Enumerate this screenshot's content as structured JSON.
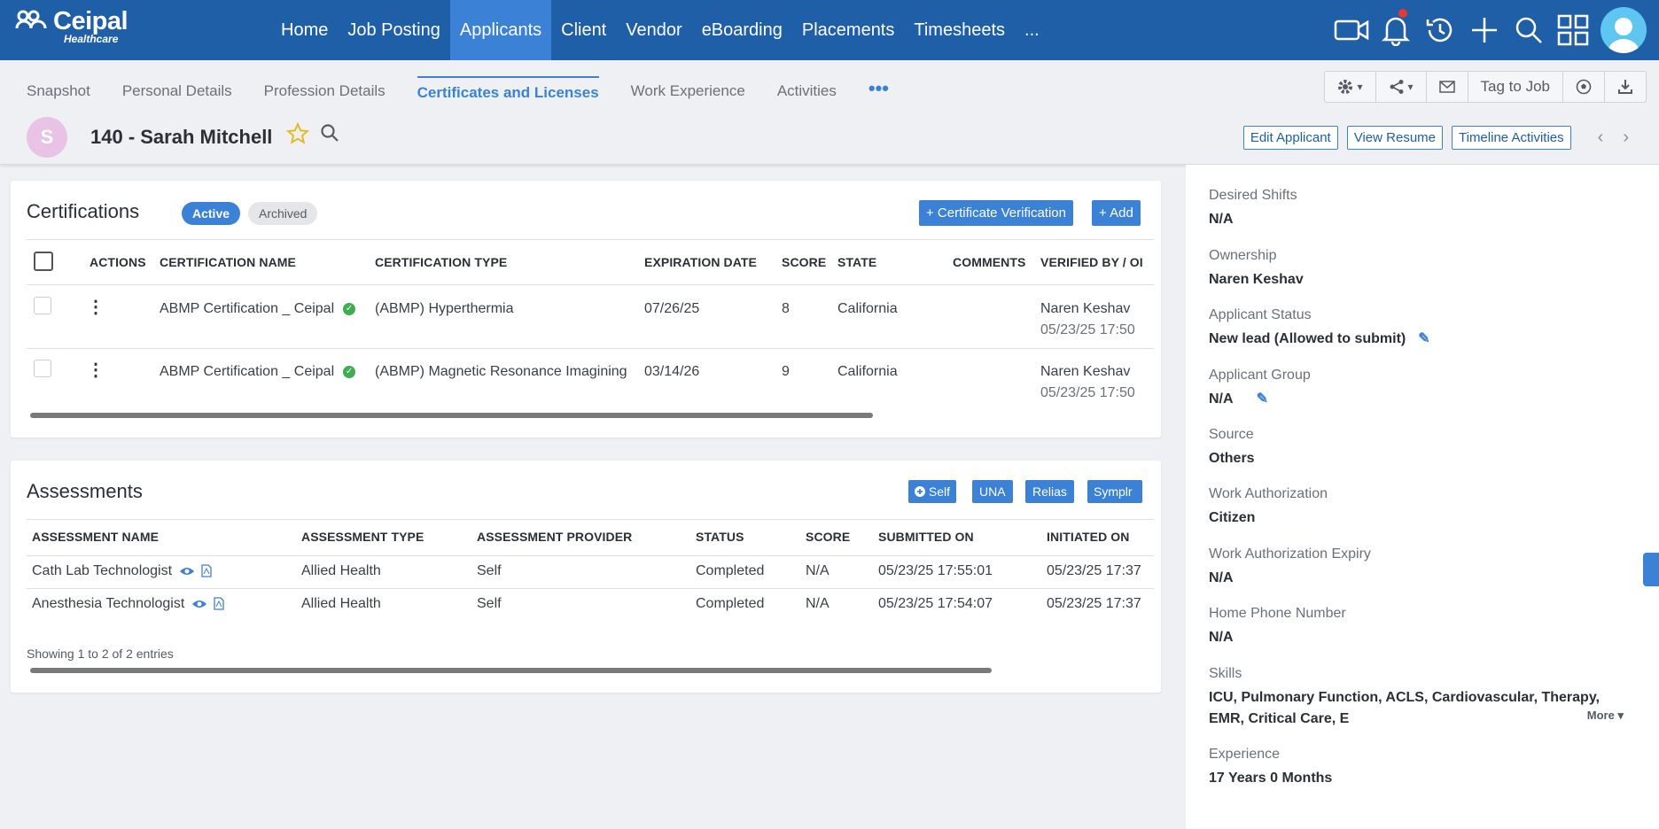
{
  "brand": {
    "name": "Ceipal",
    "sub": "Healthcare"
  },
  "nav": [
    {
      "label": "Home"
    },
    {
      "label": "Job Posting"
    },
    {
      "label": "Applicants",
      "active": true
    },
    {
      "label": "Client"
    },
    {
      "label": "Vendor"
    },
    {
      "label": "eBoarding"
    },
    {
      "label": "Placements"
    },
    {
      "label": "Timesheets"
    },
    {
      "label": "..."
    }
  ],
  "tabs": [
    {
      "label": "Snapshot"
    },
    {
      "label": "Personal Details"
    },
    {
      "label": "Profession Details"
    },
    {
      "label": "Certificates and Licenses",
      "active": true
    },
    {
      "label": "Work Experience"
    },
    {
      "label": "Activities"
    }
  ],
  "toolbar": {
    "tag_to_job": "Tag to Job"
  },
  "profile": {
    "initial": "S",
    "id_name": "140 -  Sarah Mitchell"
  },
  "actions": {
    "edit": "Edit Applicant",
    "resume": "View Resume",
    "timeline": "Timeline Activities"
  },
  "certifications": {
    "title": "Certifications",
    "active": "Active",
    "archived": "Archived",
    "verify_btn": "+ Certificate Verification",
    "add_btn": "+ Add",
    "headers": [
      "ACTIONS",
      "CERTIFICATION NAME",
      "CERTIFICATION TYPE",
      "EXPIRATION DATE",
      "SCORE",
      "STATE",
      "COMMENTS",
      "VERIFIED BY / OI"
    ],
    "rows": [
      {
        "name": "ABMP Certification _ Ceipal",
        "type": "(ABMP) Hyperthermia",
        "expiration": "07/26/25",
        "score": "8",
        "state": "California",
        "verified_by": "Naren Keshav",
        "verified_on": "05/23/25 17:50"
      },
      {
        "name": "ABMP Certification _ Ceipal",
        "type": "(ABMP) Magnetic Resonance Imagining",
        "expiration": "03/14/26",
        "score": "9",
        "state": "California",
        "verified_by": "Naren Keshav",
        "verified_on": "05/23/25 17:50"
      }
    ]
  },
  "assessments": {
    "title": "Assessments",
    "buttons": {
      "self": "Self",
      "una": "UNA",
      "relias": "Relias",
      "symplr": "Symplr"
    },
    "headers": [
      "ASSESSMENT NAME",
      "ASSESSMENT TYPE",
      "ASSESSMENT PROVIDER",
      "STATUS",
      "SCORE",
      "SUBMITTED ON",
      "INITIATED ON"
    ],
    "rows": [
      {
        "name": "Cath Lab Technologist",
        "type": "Allied Health",
        "provider": "Self",
        "status": "Completed",
        "score": "N/A",
        "submitted": "05/23/25 17:55:01",
        "initiated": "05/23/25 17:37"
      },
      {
        "name": "Anesthesia Technologist",
        "type": "Allied Health",
        "provider": "Self",
        "status": "Completed",
        "score": "N/A",
        "submitted": "05/23/25 17:54:07",
        "initiated": "05/23/25 17:37"
      }
    ],
    "footer": "Showing 1 to 2 of 2 entries"
  },
  "details": [
    {
      "label": "Desired Shifts",
      "value": "N/A"
    },
    {
      "label": "Ownership",
      "value": "Naren Keshav"
    },
    {
      "label": "Applicant Status",
      "value": "New lead (Allowed to submit)"
    },
    {
      "label": "Applicant Group",
      "value": "N/A"
    },
    {
      "label": "Source",
      "value": "Others"
    },
    {
      "label": "Work Authorization",
      "value": "Citizen"
    },
    {
      "label": "Work Authorization Expiry",
      "value": "N/A"
    },
    {
      "label": "Home Phone Number",
      "value": "N/A"
    },
    {
      "label": "Skills",
      "value": "ICU, Pulmonary Function, ACLS, Cardiovascular, Therapy, EMR, Critical Care, E"
    },
    {
      "label": "Experience",
      "value": "17 Years 0 Months"
    }
  ],
  "skills_more": "More",
  "colors": {
    "nav": "#1f5fa8",
    "accent": "#3b82d6",
    "verified": "#3caf50"
  }
}
